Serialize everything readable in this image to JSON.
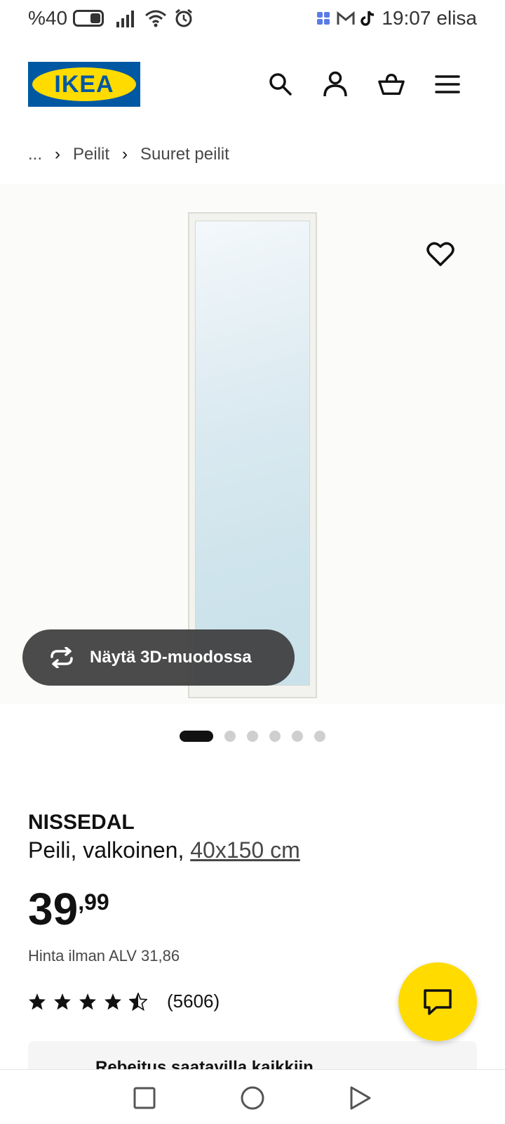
{
  "status_bar": {
    "battery": "%40",
    "time": "19:07",
    "carrier": "elisa"
  },
  "header": {
    "logo_text": "IKEA",
    "brand_colors": {
      "blue": "#0058a3",
      "yellow": "#ffdb00"
    },
    "icons": [
      "search-icon",
      "account-icon",
      "basket-icon",
      "menu-icon"
    ]
  },
  "breadcrumb": {
    "items": [
      "...",
      "Peilit",
      "Suuret peilit"
    ]
  },
  "gallery": {
    "view_3d_label": "Näytä 3D-muodossa",
    "image_count": 6,
    "active_index": 0
  },
  "product": {
    "name": "NISSEDAL",
    "description": "Peili, valkoinen,",
    "size": "40x150 cm",
    "price_int": "39",
    "price_dec": ",99",
    "vat_text": "Hinta ilman ALV 31,86",
    "rating": 4.5,
    "rating_count": "(5606)"
  },
  "availability": {
    "text": "Rebeitus saatavilla kaikkiin"
  }
}
